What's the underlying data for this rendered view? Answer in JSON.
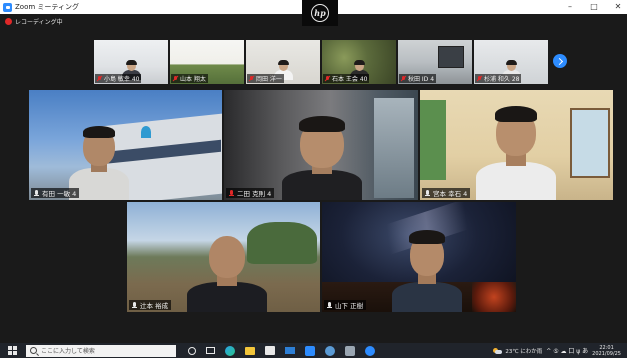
{
  "window": {
    "title": "Zoom ミーティング",
    "controls": [
      "–",
      "□",
      "✕"
    ]
  },
  "brand": {
    "logo_text": "hp"
  },
  "recording": {
    "label": "レコーディング中"
  },
  "filmstrip": [
    {
      "name": "小島 敏幸 40",
      "muted": true
    },
    {
      "name": "山本 翔太",
      "muted": true
    },
    {
      "name": "岡田 洋一",
      "muted": true
    },
    {
      "name": "石本 王会 40",
      "muted": true
    },
    {
      "name": "秋田 ID 4",
      "muted": true
    },
    {
      "name": "杉浦 和久 28",
      "muted": true
    }
  ],
  "tiles": [
    {
      "name": "有田 一敏 4",
      "muted": false
    },
    {
      "name": "二田 克則 4",
      "muted": true
    },
    {
      "name": "宮本 幸石 4",
      "muted": false
    },
    {
      "name": "辻本 裕成",
      "muted": false
    },
    {
      "name": "山下 正樹",
      "muted": false,
      "active": true
    }
  ],
  "taskbar": {
    "search_placeholder": "ここに入力して検索",
    "weather": "23℃ にわか雨",
    "tray_symbols": "^ ⑤ ☁ 口 ψ あ",
    "time": "22:01",
    "date": "2021/09/25"
  },
  "colors": {
    "accent": "#2d8cff",
    "active_speaker": "#d9d93a",
    "muted": "#e02828",
    "background": "#1a1a1a"
  }
}
